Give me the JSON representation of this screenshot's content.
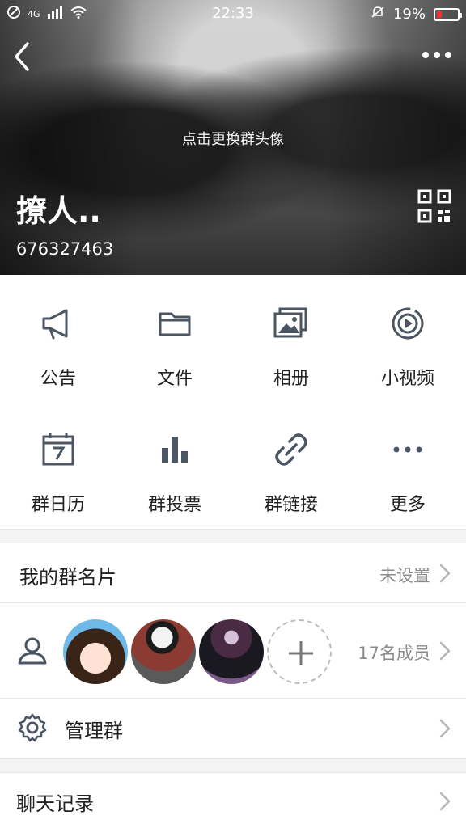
{
  "status": {
    "time": "22:33",
    "battery": "19%",
    "network": "4G"
  },
  "header": {
    "change_avatar": "点击更换群头像",
    "group_name": "撩人..",
    "group_id": "676327463"
  },
  "features": [
    {
      "label": "公告",
      "icon": "megaphone-icon"
    },
    {
      "label": "文件",
      "icon": "folder-icon"
    },
    {
      "label": "相册",
      "icon": "photo-album-icon"
    },
    {
      "label": "小视频",
      "icon": "video-icon"
    },
    {
      "label": "群日历",
      "icon": "calendar-icon"
    },
    {
      "label": "群投票",
      "icon": "bar-chart-icon"
    },
    {
      "label": "群链接",
      "icon": "link-icon"
    },
    {
      "label": "更多",
      "icon": "more-dots-icon"
    }
  ],
  "my_card": {
    "title": "我的群名片",
    "value": "未设置"
  },
  "members": {
    "count_text": "17名成员"
  },
  "manage": {
    "title": "管理群"
  },
  "chat_history": {
    "title": "聊天记录"
  },
  "colors": {
    "icon": "#4b5563",
    "muted": "#8b8b8b",
    "battery_low": "#e33333"
  }
}
